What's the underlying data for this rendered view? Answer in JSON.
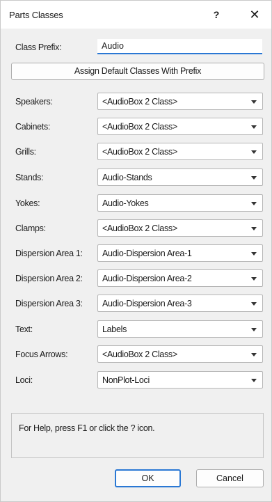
{
  "window": {
    "title": "Parts Classes",
    "help_glyph": "?",
    "close_glyph": "✕"
  },
  "class_prefix": {
    "label": "Class Prefix:",
    "value": "Audio"
  },
  "assign_button": {
    "label": "Assign Default Classes With Prefix"
  },
  "class_rows": [
    {
      "label": "Speakers:",
      "value": "<AudioBox 2 Class>"
    },
    {
      "label": "Cabinets:",
      "value": "<AudioBox 2 Class>"
    },
    {
      "label": "Grills:",
      "value": "<AudioBox 2 Class>"
    },
    {
      "label": "Stands:",
      "value": "Audio-Stands"
    },
    {
      "label": "Yokes:",
      "value": "Audio-Yokes"
    },
    {
      "label": "Clamps:",
      "value": "<AudioBox 2 Class>"
    },
    {
      "label": "Dispersion Area 1:",
      "value": "Audio-Dispersion Area-1"
    },
    {
      "label": "Dispersion Area 2:",
      "value": "Audio-Dispersion Area-2"
    },
    {
      "label": "Dispersion Area 3:",
      "value": "Audio-Dispersion Area-3"
    },
    {
      "label": "Text:",
      "value": "Labels"
    },
    {
      "label": "Focus Arrows:",
      "value": "<AudioBox 2 Class>"
    },
    {
      "label": "Loci:",
      "value": "NonPlot-Loci"
    }
  ],
  "help_panel": {
    "text": "For Help, press F1 or click the ? icon."
  },
  "buttons": {
    "ok": "OK",
    "cancel": "Cancel"
  },
  "colors": {
    "focus_accent": "#2a78d4",
    "dialog_background": "#f0f0f0",
    "titlebar_background": "#ffffff"
  }
}
